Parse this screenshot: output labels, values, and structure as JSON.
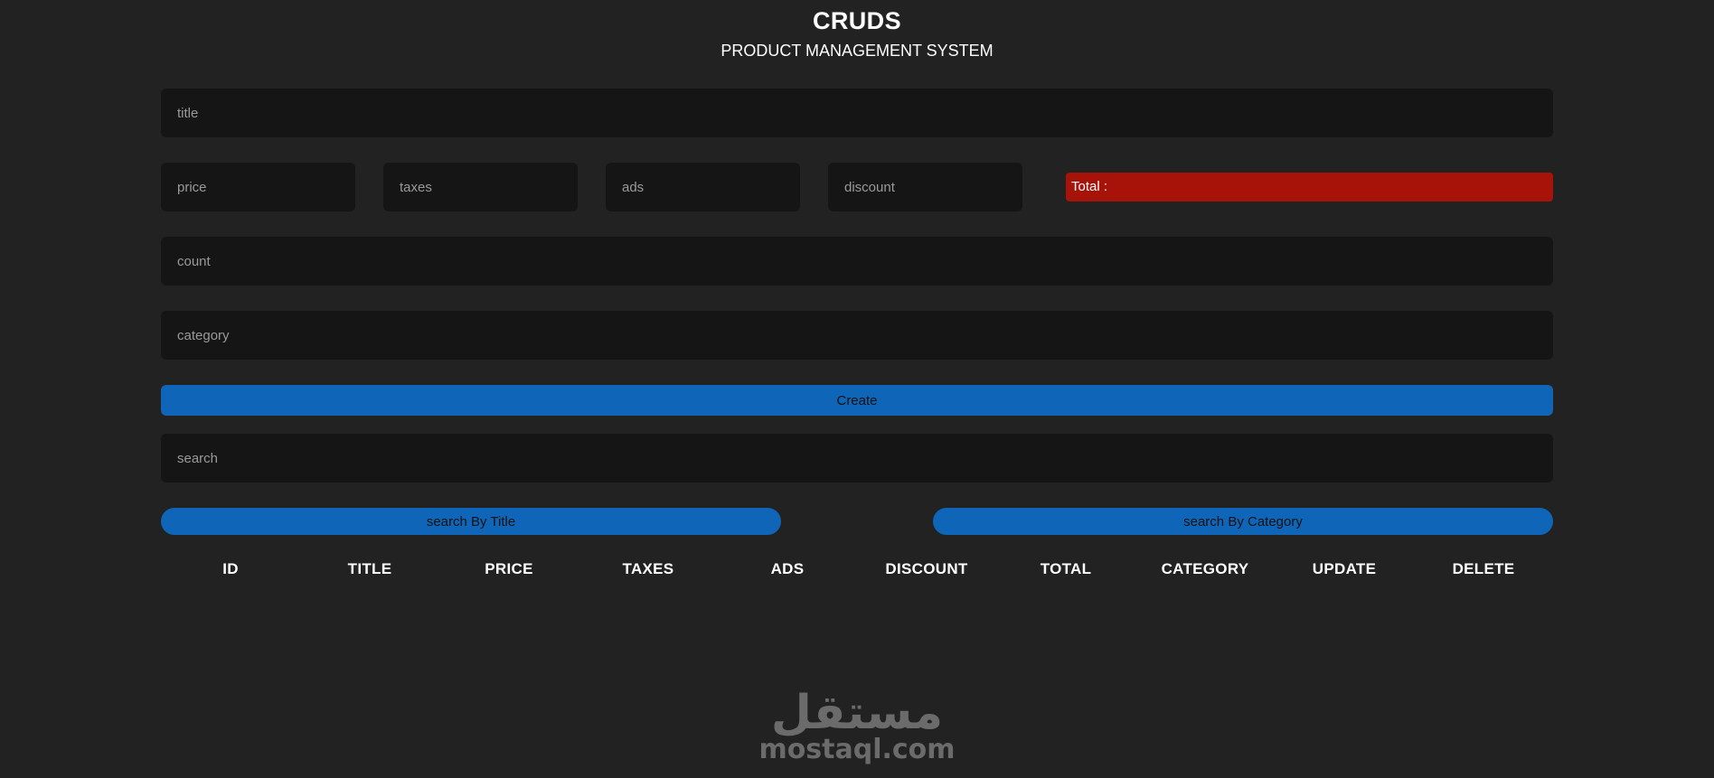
{
  "header": {
    "title": "CRUDS",
    "subtitle": "PRODUCT MANAGEMENT SYSTEM"
  },
  "form": {
    "title_placeholder": "title",
    "title_value": "",
    "price_placeholder": "price",
    "price_value": "",
    "taxes_placeholder": "taxes",
    "taxes_value": "",
    "ads_placeholder": "ads",
    "ads_value": "",
    "discount_placeholder": "discount",
    "discount_value": "",
    "total_label": "Total :",
    "total_value": "",
    "count_placeholder": "count",
    "count_value": "",
    "category_placeholder": "category",
    "category_value": "",
    "create_label": "Create"
  },
  "search": {
    "placeholder": "search",
    "value": "",
    "by_title_label": "search By Title",
    "by_category_label": "search By Category"
  },
  "table": {
    "columns": [
      "ID",
      "TITLE",
      "PRICE",
      "TAXES",
      "ADS",
      "DISCOUNT",
      "TOTAL",
      "CATEGORY",
      "UPDATE",
      "DELETE"
    ],
    "rows": []
  },
  "watermark": {
    "arabic": "مستقل",
    "latin": "mostaql.com"
  },
  "colors": {
    "background": "#222222",
    "field_background": "#151515",
    "accent_blue": "#0f66b8",
    "total_red": "#a81309",
    "text_primary": "#ffffff",
    "placeholder": "#9a9a9a"
  }
}
